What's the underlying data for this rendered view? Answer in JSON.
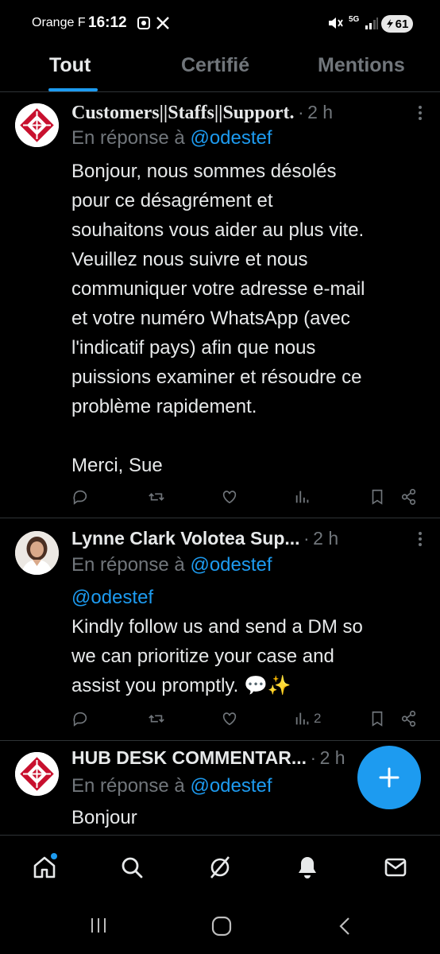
{
  "status_bar": {
    "carrier": "Orange F",
    "time": "16:12",
    "network": "5G",
    "battery": "61"
  },
  "tabs": [
    {
      "label": "Tout",
      "active": true
    },
    {
      "label": "Certifié",
      "active": false
    },
    {
      "label": "Mentions",
      "active": false
    }
  ],
  "posts": [
    {
      "author": "Customers||Staffs||Support.",
      "separator": "·",
      "time": "2 h",
      "reply_prefix": "En réponse à",
      "reply_handle": "@odestef",
      "lines": [
        "Bonjour, nous sommes désolés",
        "pour ce désagrément et",
        "souhaitons vous aider au plus vite.",
        "Veuillez nous suivre et nous",
        "communiquer votre adresse e-mail",
        "et votre numéro WhatsApp (avec",
        "l'indicatif pays) afin que nous",
        "puissions examiner et résoudre ce",
        "problème rapidement.",
        "",
        "Merci, Sue"
      ]
    },
    {
      "author": "Lynne Clark Volotea Sup...",
      "separator": "·",
      "time": "2 h",
      "reply_prefix": "En réponse à",
      "reply_handle": "@odestef",
      "mention": "@odestef",
      "lines": [
        "Kindly follow us and send a DM so",
        "we can prioritize your case and",
        "assist you promptly. 💬✨"
      ],
      "views": "2"
    },
    {
      "author": "HUB DESK COMMENTAR...",
      "separator": "·",
      "time": "2 h",
      "reply_prefix": "En réponse à",
      "reply_handle": "@odestef",
      "lines": [
        "Bonjour"
      ]
    }
  ],
  "colors": {
    "accent": "#1d9bf0",
    "muted": "#71767b",
    "text": "#e7e9ea",
    "background": "#000000"
  },
  "icons": {
    "bottom_nav": [
      "home-icon",
      "search-icon",
      "grok-icon",
      "notifications-icon",
      "messages-icon"
    ],
    "post_actions": [
      "reply-icon",
      "repost-icon",
      "like-icon",
      "views-icon",
      "bookmark-icon",
      "share-icon"
    ]
  }
}
